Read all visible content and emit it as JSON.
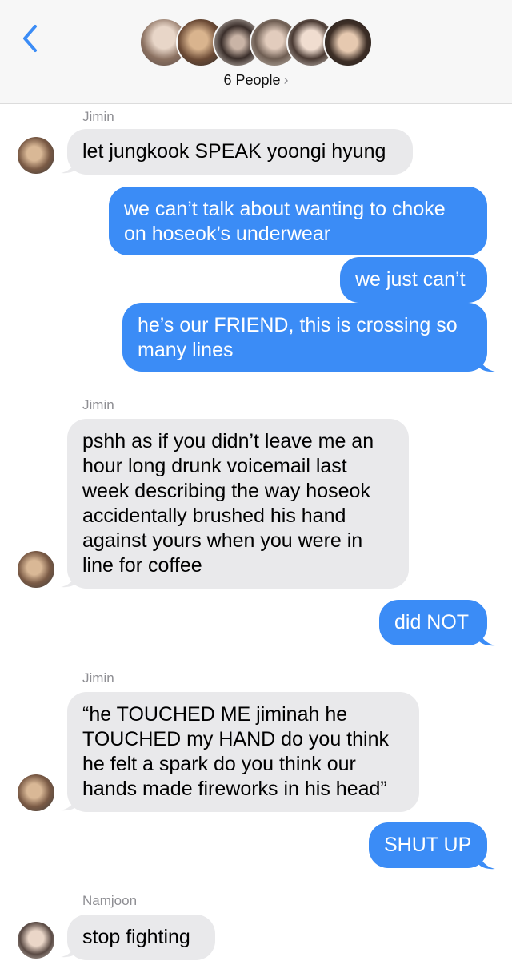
{
  "header": {
    "people_label": "6 People",
    "chevron": "›",
    "back_icon": "chevron-left-icon",
    "accent": "#3b8cf6"
  },
  "colors": {
    "incoming": "#e9e9eb",
    "outgoing": "#3b8cf6"
  },
  "messages": [
    {
      "sender": "Jimin",
      "text": "let jungkook SPEAK yoongi hyung"
    },
    {
      "text": "we can’t talk about wanting to choke on hoseok’s underwear"
    },
    {
      "text": "we just can’t"
    },
    {
      "text": "he’s our FRIEND, this is crossing so many lines"
    },
    {
      "sender": "Jimin",
      "text": "pshh as if you didn’t leave me an hour long drunk voicemail last week describing the way hoseok accidentally brushed his hand against yours when you were in line for coffee"
    },
    {
      "text": "did NOT"
    },
    {
      "sender": "Jimin",
      "text": "“he TOUCHED ME jiminah he TOUCHED my HAND do you think he felt a spark do you think our hands made fireworks in his head”"
    },
    {
      "text": "SHUT UP"
    },
    {
      "sender": "Namjoon",
      "text": "stop fighting"
    }
  ]
}
